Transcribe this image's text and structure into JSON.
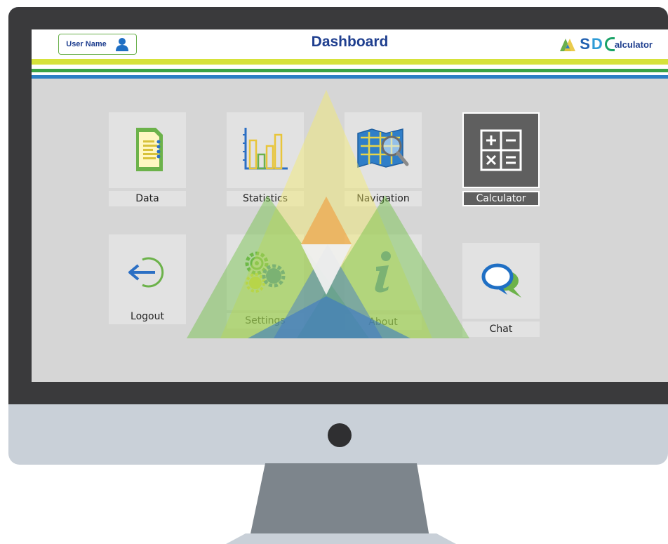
{
  "header": {
    "user_label": "User Name",
    "title": "Dashboard",
    "brand": {
      "sd": "S",
      "d": "D",
      "rest": "alculator"
    }
  },
  "tiles": [
    {
      "label": "Data",
      "icon": "document-chart-icon"
    },
    {
      "label": "Statistics",
      "icon": "bar-chart-icon"
    },
    {
      "label": "Navigation",
      "icon": "map-search-icon"
    },
    {
      "label": "Calculator",
      "icon": "calculator-icon",
      "selected": true
    },
    {
      "label": "Logout",
      "icon": "logout-arrow-icon"
    },
    {
      "label": "Settings",
      "icon": "gears-icon"
    },
    {
      "label": "About",
      "icon": "info-icon"
    },
    {
      "label": "Chat",
      "icon": "chat-bubbles-icon"
    }
  ],
  "colors": {
    "header_text": "#1f3f8f",
    "accent_green": "#6ab04c",
    "stripe_yellow": "#d6e23a",
    "stripe_green": "#3aa345",
    "stripe_blue": "#2b7fc4",
    "screen_bg": "#d6d6d6",
    "selected_tile": "#5f5f5f"
  }
}
